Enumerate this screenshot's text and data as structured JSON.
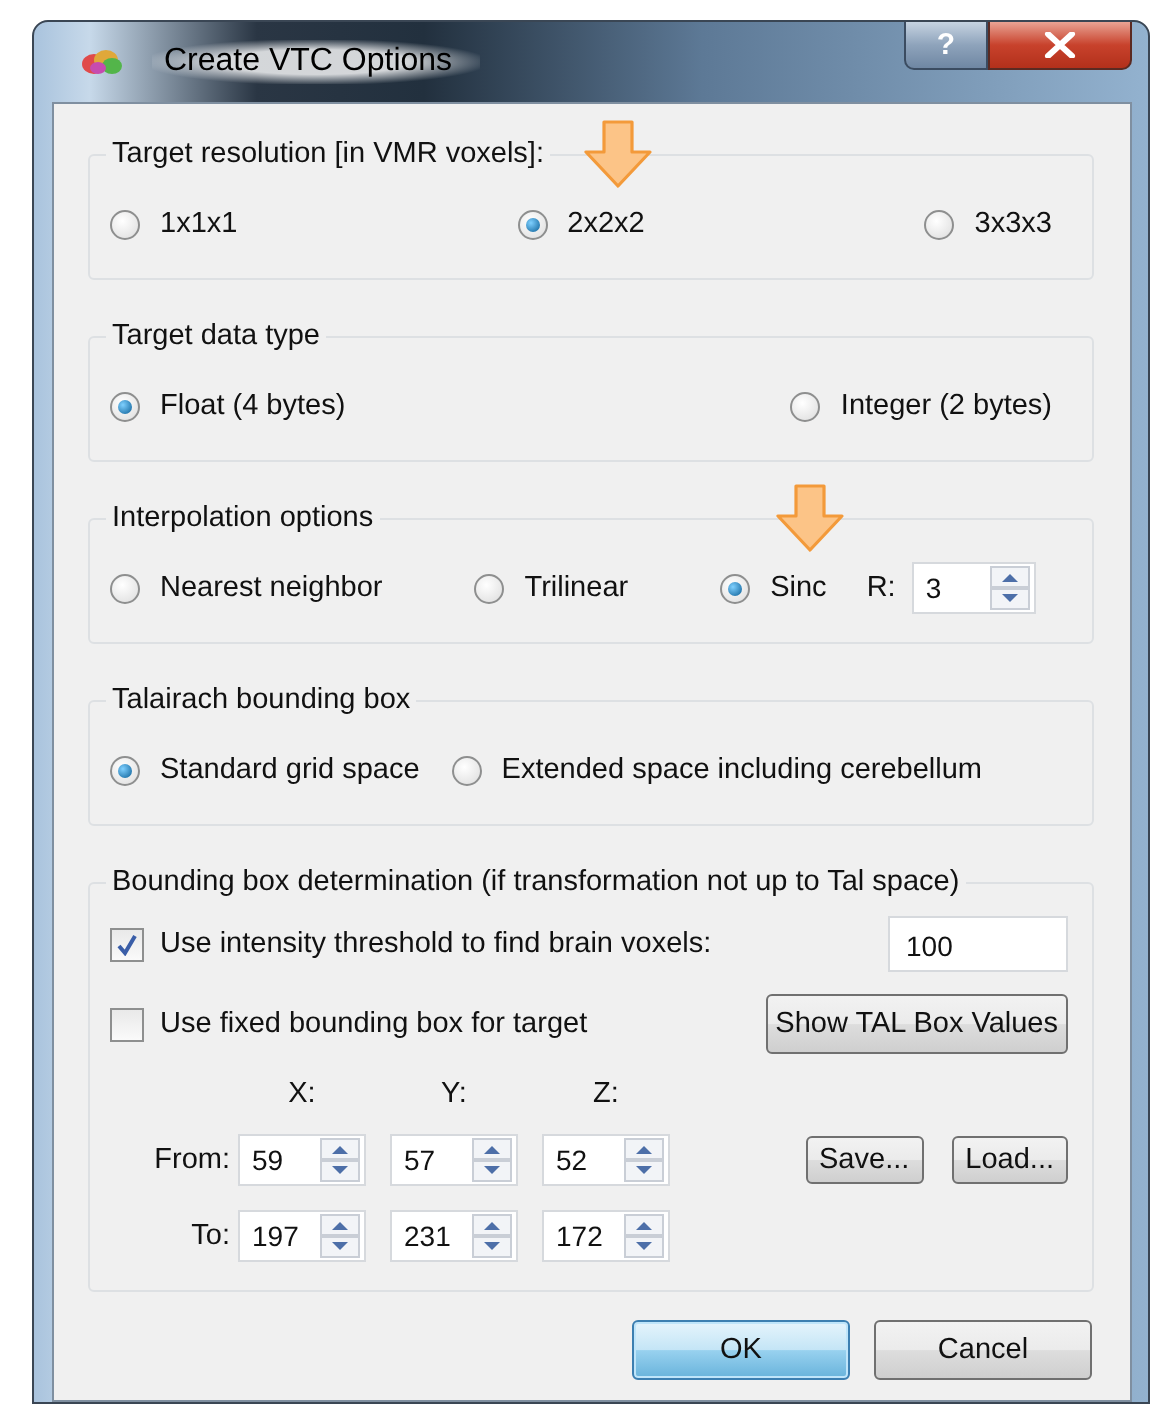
{
  "window": {
    "title": "Create VTC Options",
    "help_button": "?"
  },
  "groups": [
    {
      "kind": "spread",
      "title": "Target resolution [in VMR voxels]:",
      "options": [
        {
          "label": "1x1x1",
          "selected": false,
          "highlighted": false
        },
        {
          "label": "2x2x2",
          "selected": true,
          "highlighted": true
        },
        {
          "label": "3x3x3",
          "selected": false,
          "highlighted": false
        }
      ]
    },
    {
      "kind": "spread",
      "title": "Target data type",
      "options": [
        {
          "label": "Float (4 bytes)",
          "selected": true,
          "highlighted": false
        },
        {
          "label": "Integer (2 bytes)",
          "selected": false,
          "highlighted": false
        }
      ]
    },
    {
      "kind": "packed",
      "title": "Interpolation options",
      "options": [
        {
          "label": "Nearest neighbor",
          "selected": false,
          "highlighted": false
        },
        {
          "label": "Trilinear",
          "selected": false,
          "highlighted": false
        },
        {
          "label": "Sinc",
          "selected": true,
          "highlighted": true
        }
      ],
      "spin": {
        "label": "R:",
        "value": "3"
      }
    },
    {
      "kind": "packed",
      "title": "Talairach bounding box",
      "options": [
        {
          "label": "Standard grid space",
          "selected": true,
          "highlighted": false
        },
        {
          "label": "Extended space including cerebellum",
          "selected": false,
          "highlighted": false
        }
      ]
    },
    {
      "kind": "bounds",
      "title": "Bounding box determination (if transformation not up to Tal space)",
      "threshold": {
        "label": "Use intensity threshold to find brain voxels:",
        "checked": true,
        "value": "100"
      },
      "fixed": {
        "label": "Use fixed bounding box for target",
        "checked": false,
        "button": "Show TAL Box Values"
      },
      "axes": [
        "X:",
        "Y:",
        "Z:"
      ],
      "rows": [
        {
          "label": "From:",
          "values": [
            "59",
            "57",
            "52"
          ]
        },
        {
          "label": "To:",
          "values": [
            "197",
            "231",
            "172"
          ]
        }
      ],
      "buttons": [
        "Save...",
        "Load..."
      ]
    }
  ],
  "buttons": [
    {
      "label": "OK",
      "default": true
    },
    {
      "label": "Cancel",
      "default": false
    }
  ]
}
